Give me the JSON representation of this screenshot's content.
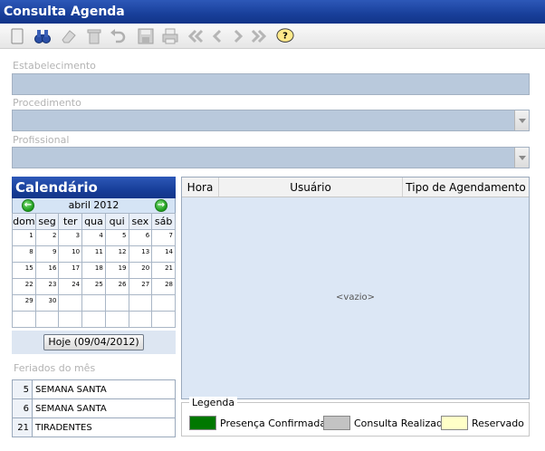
{
  "window": {
    "title": "Consulta Agenda"
  },
  "toolbar": {
    "buttons": [
      "new-icon",
      "search-binoculars-icon",
      "eraser-icon",
      "trash-icon",
      "undo-icon",
      "save-icon",
      "print-icon",
      "first-icon",
      "previous-icon",
      "next-icon",
      "last-icon",
      "help-icon"
    ],
    "help_label": "?"
  },
  "form": {
    "estabelecimento_label": "Estabelecimento",
    "estabelecimento_value": "",
    "procedimento_label": "Procedimento",
    "procedimento_value": "",
    "profissional_label": "Profissional",
    "profissional_value": ""
  },
  "calendar": {
    "title": "Calendário",
    "month": "abril 2012",
    "weekdays": [
      "dom",
      "seg",
      "ter",
      "qua",
      "qui",
      "sex",
      "sáb"
    ],
    "weeks": [
      [
        "1",
        "2",
        "3",
        "4",
        "5",
        "6",
        "7"
      ],
      [
        "8",
        "9",
        "10",
        "11",
        "12",
        "13",
        "14"
      ],
      [
        "15",
        "16",
        "17",
        "18",
        "19",
        "20",
        "21"
      ],
      [
        "22",
        "23",
        "24",
        "25",
        "26",
        "27",
        "28"
      ],
      [
        "29",
        "30",
        "",
        "",
        "",
        "",
        ""
      ],
      [
        "",
        "",
        "",
        "",
        "",
        "",
        ""
      ]
    ],
    "today_button": "Hoje (09/04/2012)"
  },
  "holidays": {
    "label": "Feriados do mês",
    "items": [
      {
        "day": "5",
        "name": "SEMANA SANTA"
      },
      {
        "day": "6",
        "name": "SEMANA SANTA"
      },
      {
        "day": "21",
        "name": "TIRADENTES"
      }
    ]
  },
  "grid": {
    "columns": [
      "Hora",
      "Usuário",
      "Tipo de Agendamento"
    ],
    "empty_text": "<vazio>"
  },
  "legend": {
    "title": "Legenda",
    "items": [
      {
        "label": "Presença Confirmada",
        "color": "#007800"
      },
      {
        "label": "Consulta Realizada",
        "color": "#c3c3c3"
      },
      {
        "label": "Reservado",
        "color": "#ffffc8"
      }
    ]
  }
}
